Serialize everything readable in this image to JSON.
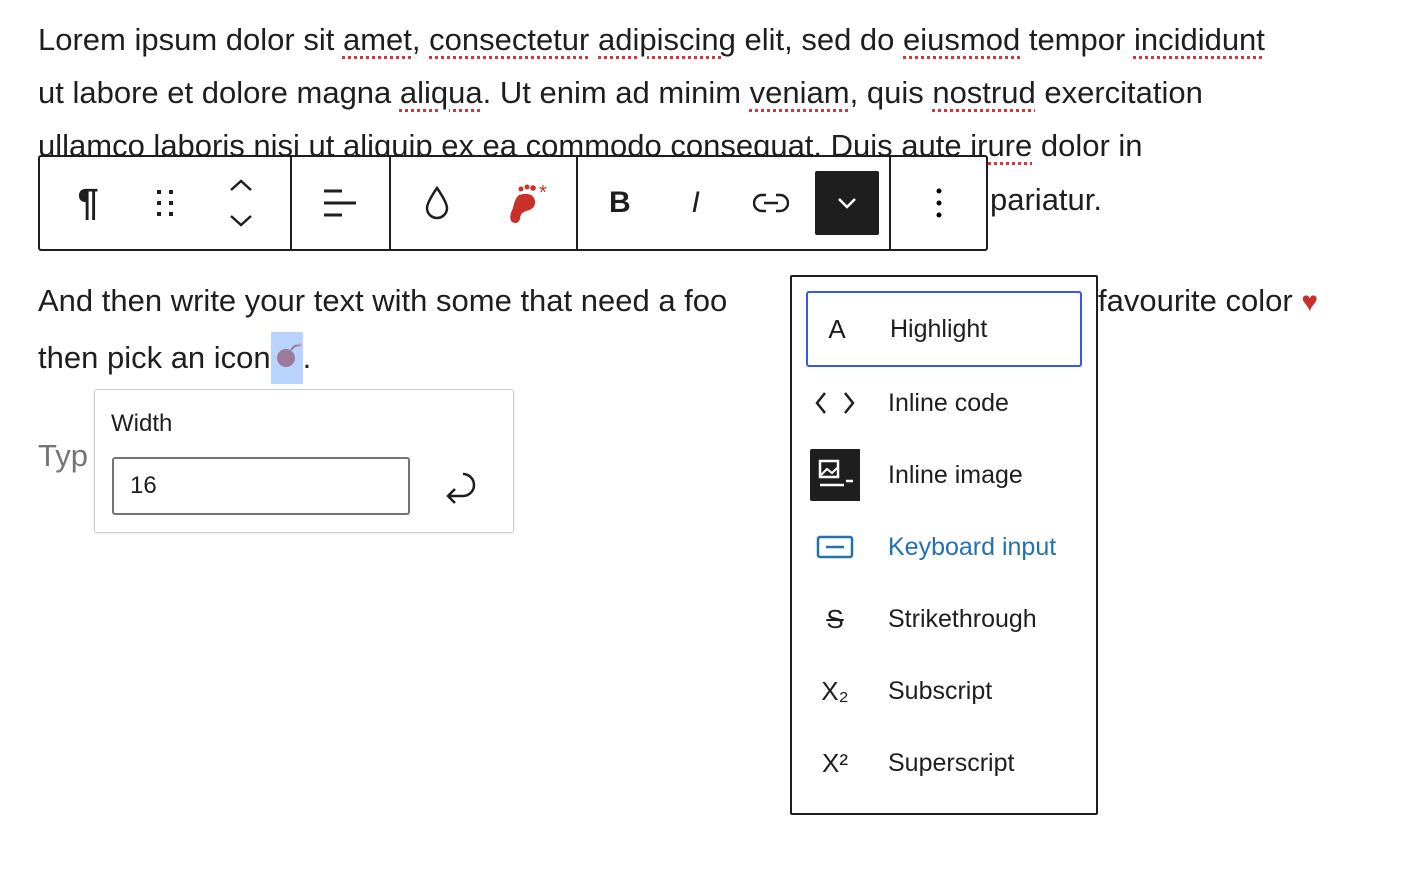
{
  "paragraph1": {
    "line1": [
      "Lorem ipsum dolor sit ",
      "amet",
      ", ",
      "consectetur",
      " ",
      "adipiscing",
      " elit, sed do ",
      "eiusmod",
      " tempor ",
      "incididunt"
    ],
    "line2": [
      "ut labore et dolore magna ",
      "aliqua",
      ". Ut enim ad minim ",
      "veniam",
      ", quis ",
      "nostrud",
      " exercitation"
    ],
    "line3": [
      "ullamco laboris nisi ut aliquip ex ea commodo consequat. Duis aute ",
      "irure",
      " dolor in"
    ],
    "line4": "pariatur."
  },
  "paragraph2": {
    "line1a": "And then write your text with some that need a foo",
    "line1b": "favourite color",
    "line2": "then pick an icon",
    "line2_end": "."
  },
  "placeholder": "Typ",
  "toolbar": {
    "icons": [
      "paragraph-icon",
      "drag-handle-icon",
      "move-up-down-icon",
      "align-icon",
      "drop-color-icon",
      "footnote-icon",
      "bold-icon",
      "italic-icon",
      "link-icon",
      "more-rich-text-icon",
      "options-icon"
    ],
    "bold": "B",
    "italic": "I"
  },
  "menu": {
    "items": [
      {
        "label": "Highlight",
        "icon": "A"
      },
      {
        "label": "Inline code",
        "icon": "< >"
      },
      {
        "label": "Inline image",
        "icon": "image-icon"
      },
      {
        "label": "Keyboard input",
        "icon": "keyboard-icon"
      },
      {
        "label": "Strikethrough",
        "icon": "S"
      },
      {
        "label": "Subscript",
        "icon": "X₂"
      },
      {
        "label": "Superscript",
        "icon": "X²"
      }
    ],
    "accent": "#3858e9",
    "link_color": "#2271b1"
  },
  "width_popover": {
    "label": "Width",
    "value": "16"
  },
  "colors": {
    "heart": "#c9302c",
    "footnote": "#c9302c",
    "selection": "#b8d4fc"
  }
}
